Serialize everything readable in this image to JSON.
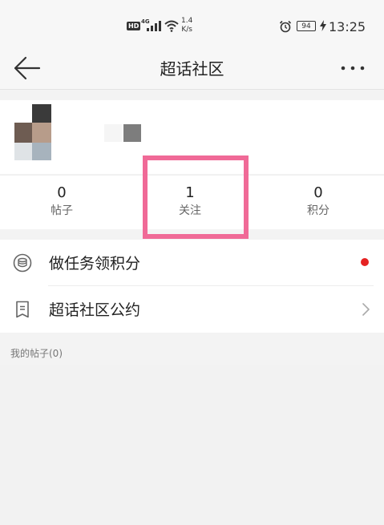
{
  "status_bar": {
    "hd": "HD",
    "network": "4G",
    "speed_value": "1.4",
    "speed_unit": "K/s",
    "battery": "94",
    "time": "13:25"
  },
  "header": {
    "title": "超话社区"
  },
  "stats": [
    {
      "value": "0",
      "label": "帖子"
    },
    {
      "value": "1",
      "label": "关注"
    },
    {
      "value": "0",
      "label": "积分"
    }
  ],
  "menu": {
    "tasks_label": "做任务领积分",
    "convention_label": "超话社区公约"
  },
  "section": {
    "my_posts": "我的帖子(0)"
  },
  "colors": {
    "highlight": "#f06a97",
    "notification_dot": "#e52222"
  },
  "icons": {
    "back": "arrow-left-icon",
    "more": "more-dots-icon",
    "tasks": "coin-stack-icon",
    "convention": "document-icon",
    "chevron": "chevron-right-icon"
  }
}
